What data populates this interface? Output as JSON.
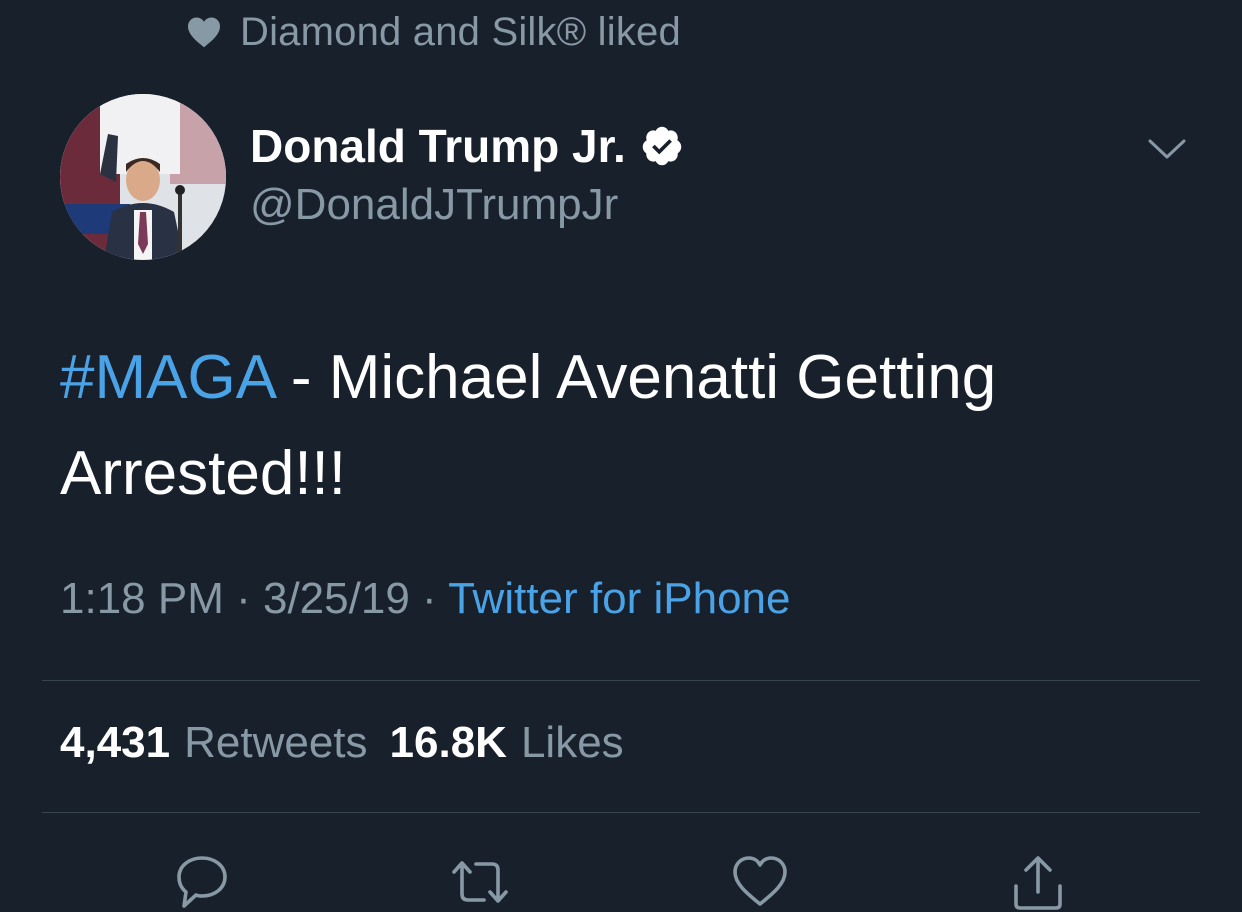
{
  "social_context": {
    "text": "Diamond and Silk® liked",
    "icon": "heart-icon"
  },
  "author": {
    "name": "Donald Trump Jr.",
    "handle": "@DonaldJTrumpJr",
    "verified": true
  },
  "tweet": {
    "hashtag": "#MAGA",
    "body": " - Michael Avenatti Getting Arrested!!!"
  },
  "meta": {
    "time": "1:18 PM",
    "sep1": " · ",
    "date": "3/25/19",
    "sep2": " · ",
    "source": "Twitter for iPhone"
  },
  "stats": {
    "retweets_count": "4,431",
    "retweets_label": "Retweets",
    "likes_count": "16.8K",
    "likes_label": "Likes"
  },
  "actions": [
    "reply-icon",
    "retweet-icon",
    "like-icon",
    "share-icon"
  ],
  "colors": {
    "background": "#18202b",
    "link": "#4aa3e6",
    "secondary_text": "#8899a6",
    "divider": "#38444d"
  }
}
